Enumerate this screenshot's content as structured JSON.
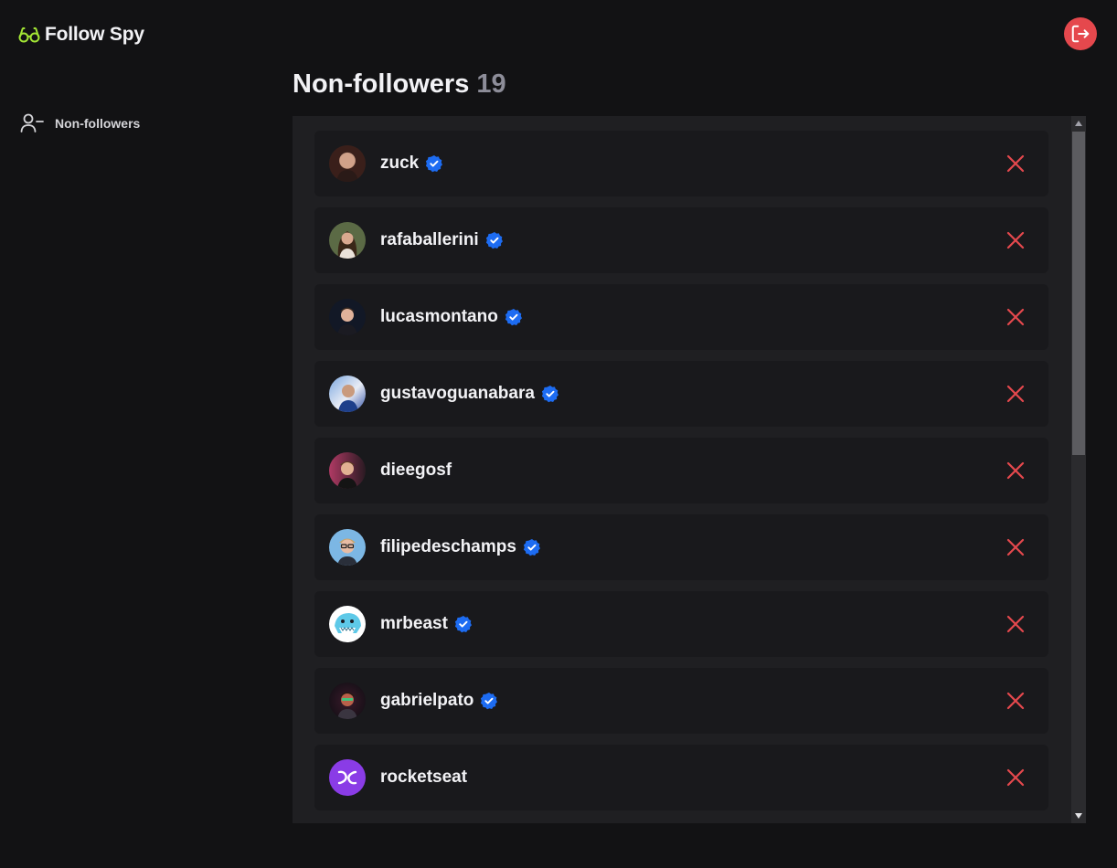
{
  "brand": {
    "title": "Follow Spy",
    "icon": "glasses-icon",
    "accent": "#a3e635"
  },
  "header": {
    "logout_icon": "logout-icon",
    "logout_color": "#e5484d"
  },
  "sidebar": {
    "items": [
      {
        "label": "Non-followers",
        "icon": "user-minus-icon"
      }
    ]
  },
  "page": {
    "title": "Non-followers",
    "count": "19"
  },
  "list": {
    "items": [
      {
        "username": "zuck",
        "verified": true
      },
      {
        "username": "rafaballerini",
        "verified": true
      },
      {
        "username": "lucasmontano",
        "verified": true
      },
      {
        "username": "gustavoguanabara",
        "verified": true
      },
      {
        "username": "dieegosf",
        "verified": false
      },
      {
        "username": "filipedeschamps",
        "verified": true
      },
      {
        "username": "mrbeast",
        "verified": true
      },
      {
        "username": "gabrielpato",
        "verified": true
      },
      {
        "username": "rocketseat",
        "verified": false
      }
    ],
    "remove_icon": "close-icon",
    "remove_color": "#e5484d",
    "verified_color": "#1d6cf2"
  }
}
